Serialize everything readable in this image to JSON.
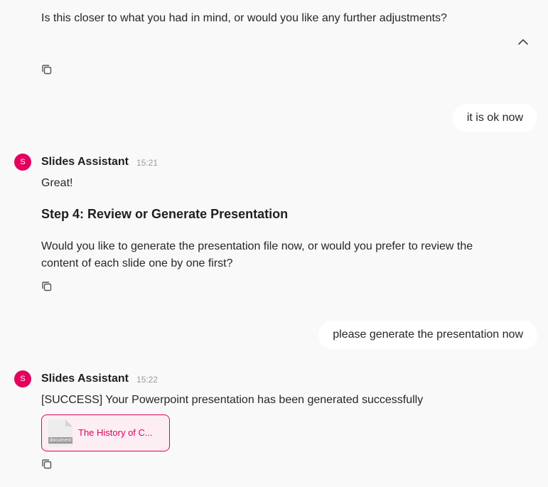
{
  "colors": {
    "background": "#f9f9f9",
    "accent": "#e3005e",
    "user_bubble": "#ffffff",
    "timestamp": "#9a9a9a"
  },
  "messages": [
    {
      "role": "assistant",
      "text": "Is this closer to what you had in mind, or would you like any further adjustments?",
      "icons": [
        "chevron-up-icon",
        "copy-icon"
      ]
    },
    {
      "role": "user",
      "text": "it is ok now"
    },
    {
      "role": "assistant",
      "avatar": "S",
      "sender": "Slides Assistant",
      "time": "15:21",
      "greeting": "Great!",
      "heading": "Step 4: Review or Generate Presentation",
      "body_line1": "Would you like to generate the presentation file now, or would you prefer to review the",
      "body_line2": "content of each slide one by one first?",
      "icons": [
        "copy-icon"
      ]
    },
    {
      "role": "user",
      "text": "please generate the presentation now"
    },
    {
      "role": "assistant",
      "avatar": "S",
      "sender": "Slides Assistant",
      "time": "15:22",
      "text": "[SUCCESS] Your Powerpoint presentation has been generated successfully",
      "attachment": {
        "badge": "document",
        "name": "The History of C..."
      },
      "icons": [
        "copy-icon"
      ]
    }
  ]
}
